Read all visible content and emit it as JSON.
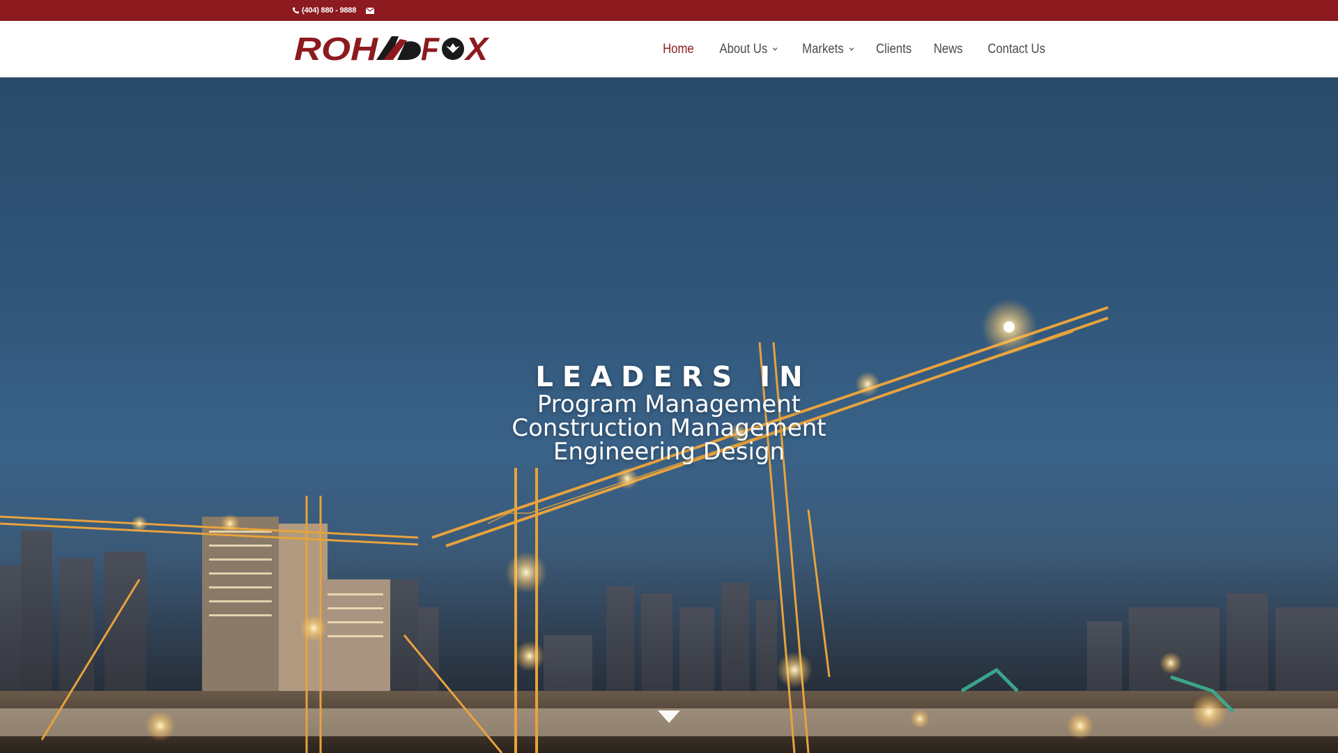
{
  "topbar": {
    "phone": "(404) 880 - 9888",
    "phone_icon": "phone-icon",
    "mail_icon": "mail-icon",
    "bg_color": "#8c1a1f"
  },
  "header": {
    "logo_text": "ROHADFOX",
    "nav": [
      {
        "label": "Home",
        "active": true,
        "has_dropdown": false
      },
      {
        "label": "About Us",
        "active": false,
        "has_dropdown": true
      },
      {
        "label": "Markets",
        "active": false,
        "has_dropdown": true
      },
      {
        "label": "Clients",
        "active": false,
        "has_dropdown": false
      },
      {
        "label": "News",
        "active": false,
        "has_dropdown": false
      },
      {
        "label": "Contact Us",
        "active": false,
        "has_dropdown": false
      }
    ],
    "accent_color": "#8c1a1f"
  },
  "hero": {
    "kicker": "LEADERS IN",
    "lines": [
      "Program Management",
      "Construction Management",
      "Engineering Design"
    ],
    "scroll_icon": "chevron-down-icon"
  }
}
